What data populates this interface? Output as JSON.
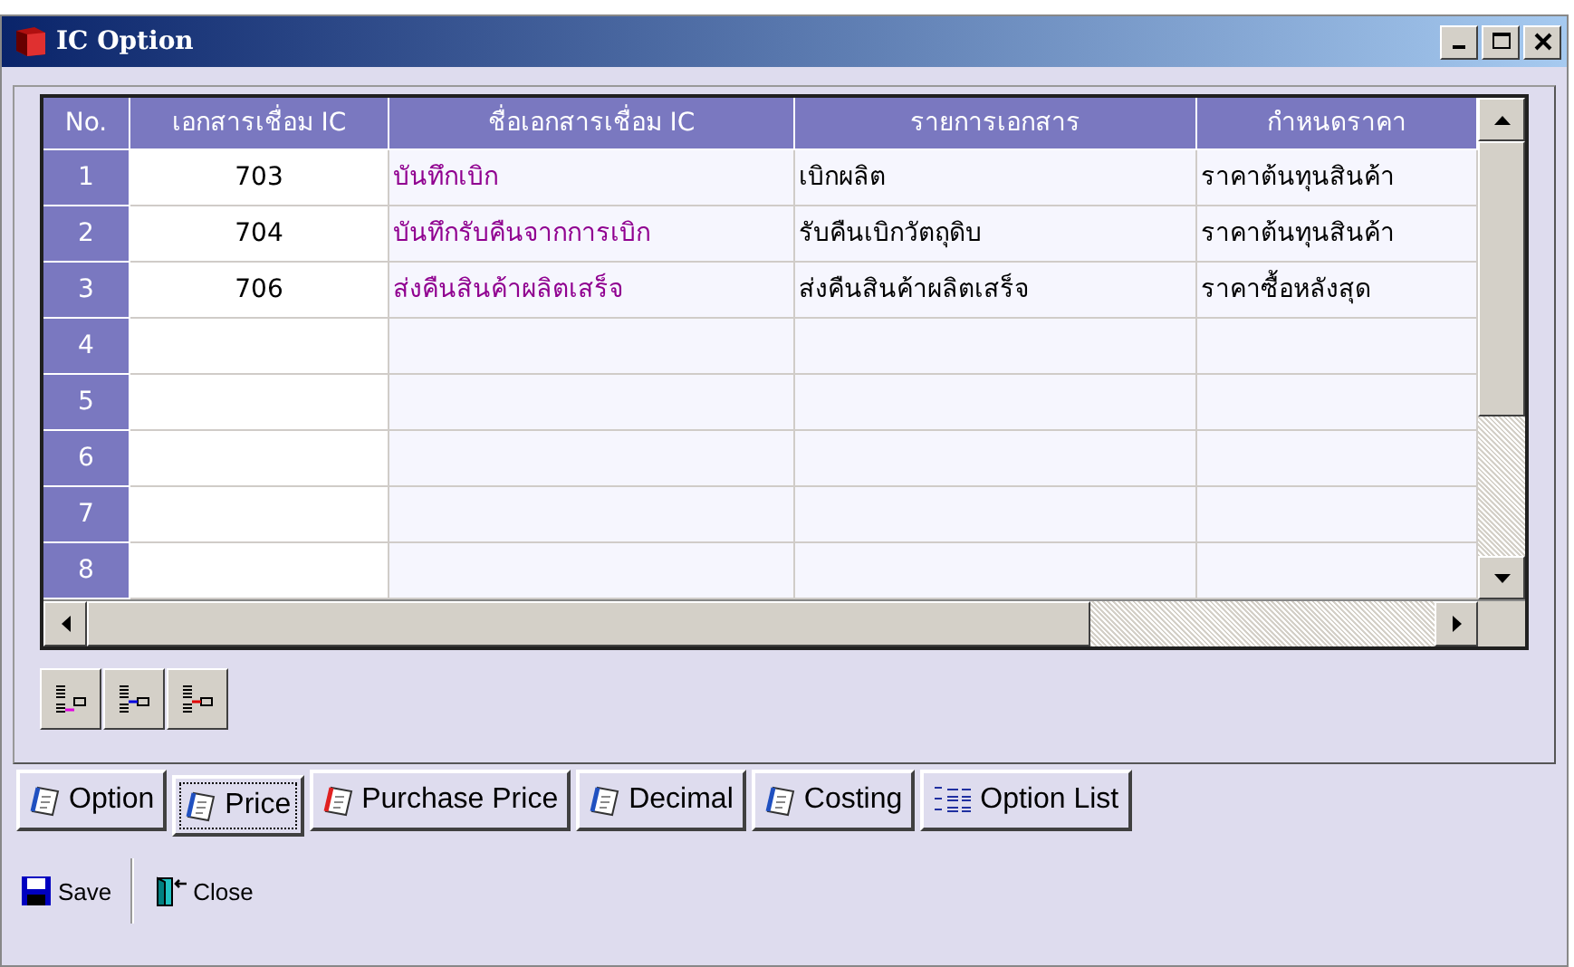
{
  "window": {
    "title": "IC Option"
  },
  "table": {
    "columns": [
      "No.",
      "เอกสารเชื่อม IC",
      "ชื่อเอกสารเชื่อม IC",
      "รายการเอกสาร",
      "กำหนดราคา"
    ],
    "rows": [
      {
        "cells": [
          "1",
          "703",
          "บันทึกเบิก",
          "เบิกผลิต",
          "ราคาต้นทุนสินค้า"
        ]
      },
      {
        "cells": [
          "2",
          "704",
          "บันทึกรับคืนจากการเบิก",
          "รับคืนเบิกวัตถุดิบ",
          "ราคาต้นทุนสินค้า"
        ]
      },
      {
        "cells": [
          "3",
          "706",
          "ส่งคืนสินค้าผลิตเสร็จ",
          "ส่งคืนสินค้าผลิตเสร็จ",
          "ราคาซื้อหลังสุด"
        ]
      },
      {
        "cells": [
          "4",
          "",
          "",
          "",
          ""
        ]
      },
      {
        "cells": [
          "5",
          "",
          "",
          "",
          ""
        ]
      },
      {
        "cells": [
          "6",
          "",
          "",
          "",
          ""
        ]
      },
      {
        "cells": [
          "7",
          "",
          "",
          "",
          ""
        ]
      },
      {
        "cells": [
          "8",
          "",
          "",
          "",
          ""
        ]
      }
    ]
  },
  "tabs": [
    {
      "label": "Option",
      "selected": false,
      "kind": "page"
    },
    {
      "label": "Price",
      "selected": true,
      "kind": "page"
    },
    {
      "label": "Purchase Price",
      "selected": false,
      "kind": "page-red"
    },
    {
      "label": "Decimal",
      "selected": false,
      "kind": "page"
    },
    {
      "label": "Costing",
      "selected": false,
      "kind": "page"
    },
    {
      "label": "Option List",
      "selected": false,
      "kind": "list"
    }
  ],
  "toolbar": [
    {
      "label": "Save",
      "kind": "save"
    },
    {
      "label": "Close",
      "kind": "close"
    }
  ]
}
